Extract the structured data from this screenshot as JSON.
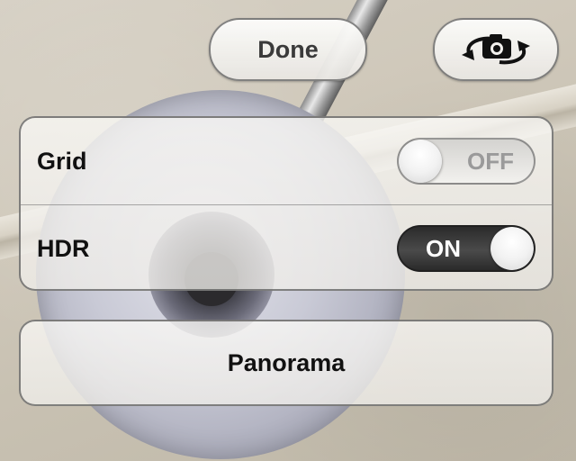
{
  "header": {
    "done_label": "Done",
    "flip_icon": "camera-flip-icon"
  },
  "settings": {
    "grid": {
      "label": "Grid",
      "state": "OFF"
    },
    "hdr": {
      "label": "HDR",
      "state": "ON"
    }
  },
  "modes": {
    "panorama_label": "Panorama"
  },
  "colors": {
    "toggle_on": "#333333",
    "toggle_off": "#e6e5e2",
    "panel": "#f2f1ee"
  }
}
